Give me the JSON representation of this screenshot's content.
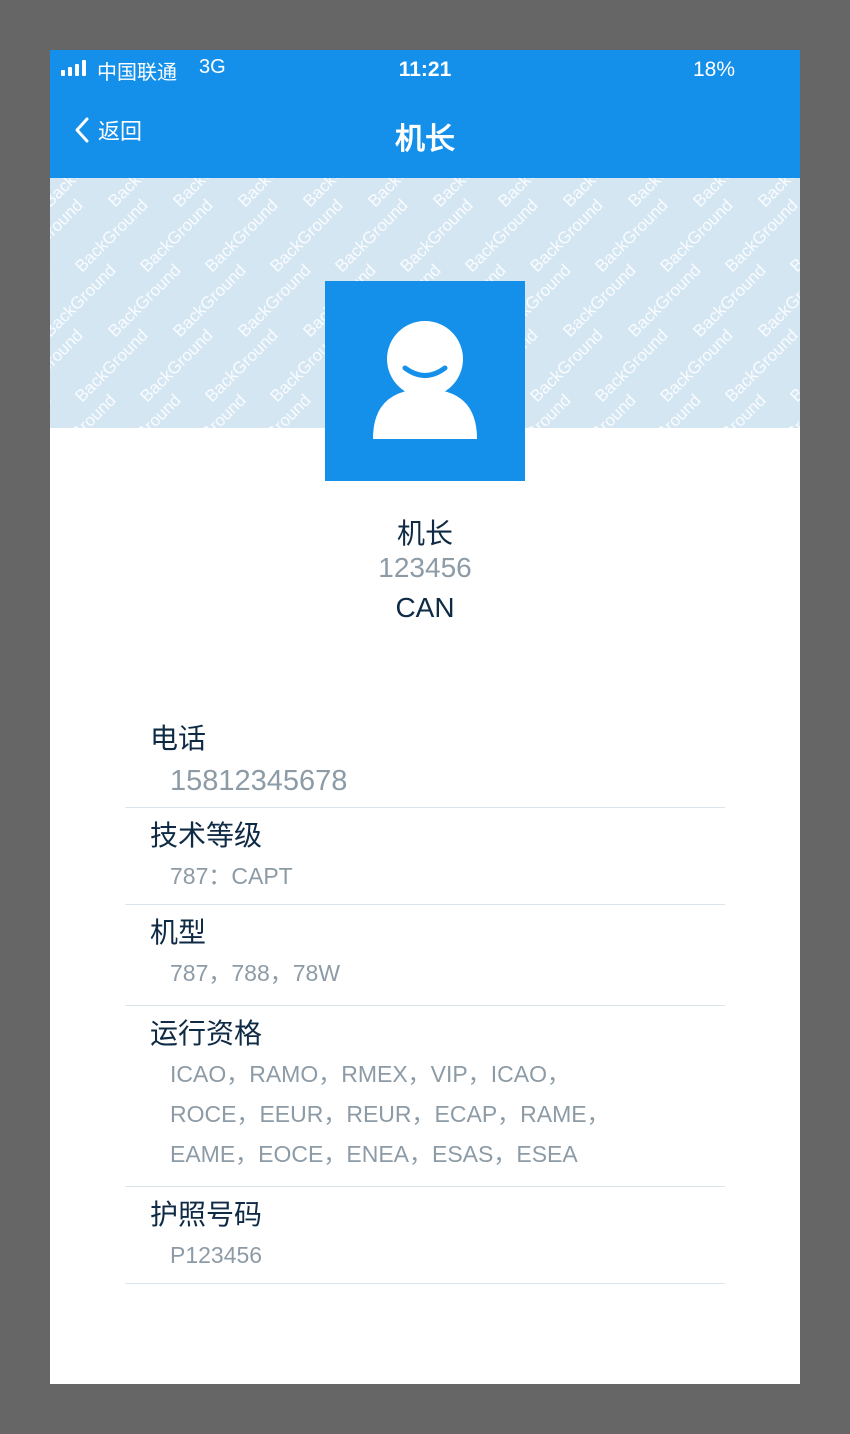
{
  "status_bar": {
    "carrier": "中国联通",
    "network": "3G",
    "time": "11:21",
    "battery": "18%"
  },
  "nav": {
    "back_label": "返回",
    "title": "机长"
  },
  "banner": {
    "watermark_text": "BackGround",
    "color": "#d5e6f3"
  },
  "profile": {
    "name": "机长",
    "id": "123456",
    "base": "CAN"
  },
  "info": {
    "phone": {
      "label": "电话",
      "value": "15812345678"
    },
    "tech_level": {
      "label": "技术等级",
      "value": "787：CAPT"
    },
    "aircraft_type": {
      "label": "机型",
      "value": "787，788，78W"
    },
    "qualifications": {
      "label": "运行资格",
      "lines": [
        "ICAO，RAMO，RMEX，VIP，ICAO，",
        "ROCE，EEUR，REUR，ECAP，RAME，",
        "EAME，EOCE，ENEA，ESAS，ESEA"
      ]
    },
    "passport": {
      "label": "护照号码",
      "value": "P123456"
    }
  },
  "colors": {
    "primary": "#1590ea",
    "text_dark": "#0f2a45",
    "text_gray": "#8c9ba6",
    "divider": "#d8e6ec",
    "backdrop": "#666666"
  },
  "icons": {
    "back": "chevron-left-icon",
    "avatar": "user-avatar-icon",
    "signal": "signal-bars-icon"
  }
}
